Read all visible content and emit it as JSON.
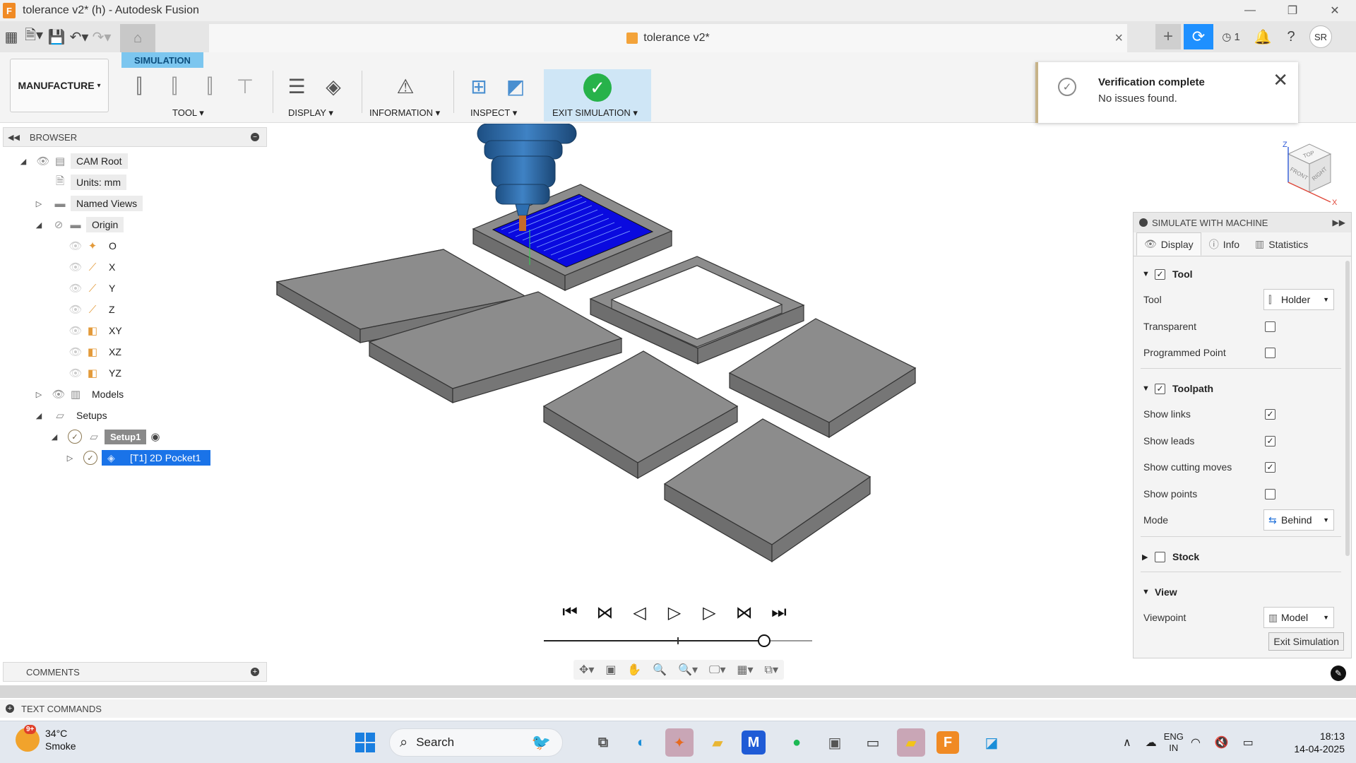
{
  "window": {
    "title": "tolerance v2* (h) - Autodesk Fusion",
    "app_letter": "F",
    "controls": [
      "—",
      "❐",
      "✕"
    ]
  },
  "tabs": {
    "document_title": "tolerance v2*",
    "jobs_count": "1",
    "avatar": "SR"
  },
  "ribbon": {
    "workspace": "MANUFACTURE",
    "active_tab": "SIMULATION",
    "groups": {
      "tool": "TOOL",
      "display": "DISPLAY",
      "information": "INFORMATION",
      "inspect": "INSPECT",
      "exit_simulation": "EXIT SIMULATION"
    }
  },
  "notification": {
    "title": "Verification complete",
    "message": "No issues found."
  },
  "browser": {
    "title": "BROWSER",
    "tree": {
      "cam_root": "CAM Root",
      "units": "Units: mm",
      "named_views": "Named Views",
      "origin": "Origin",
      "o": "O",
      "x": "X",
      "y": "Y",
      "z": "Z",
      "xy": "XY",
      "xz": "XZ",
      "yz": "YZ",
      "models": "Models",
      "setups": "Setups",
      "setup1": "Setup1",
      "pocket": "[T1] 2D Pocket1"
    },
    "comments": "COMMENTS"
  },
  "viewcube": {
    "top": "TOP",
    "front": "FRONT",
    "right": "RIGHT",
    "z": "Z",
    "x": "X"
  },
  "playback": {
    "position": 0.82,
    "marker": 0.5
  },
  "simulate_panel": {
    "title": "SIMULATE WITH MACHINE",
    "tabs": [
      "Display",
      "Info",
      "Statistics"
    ],
    "tool_section": "Tool",
    "tool_label": "Tool",
    "tool_value": "Holder",
    "transparent": "Transparent",
    "programmed_point": "Programmed Point",
    "toolpath_section": "Toolpath",
    "show_links": "Show links",
    "show_leads": "Show leads",
    "show_cutting_moves": "Show cutting moves",
    "show_points": "Show points",
    "mode_label": "Mode",
    "mode_value": "Behind",
    "stock_section": "Stock",
    "view_section": "View",
    "viewpoint_label": "Viewpoint",
    "viewpoint_value": "Model",
    "exit_button": "Exit Simulation",
    "check": {
      "tool": true,
      "transparent": false,
      "programmed_point": false,
      "toolpath": true,
      "show_links": true,
      "show_leads": true,
      "show_cutting_moves": true,
      "show_points": false,
      "stock": false
    }
  },
  "text_commands": "TEXT COMMANDS",
  "taskbar": {
    "badge": "9+",
    "temperature": "34°C",
    "condition": "Smoke",
    "search": "Search",
    "lang_1": "ENG",
    "lang_2": "IN",
    "time": "18:13",
    "date": "14-04-2025"
  }
}
